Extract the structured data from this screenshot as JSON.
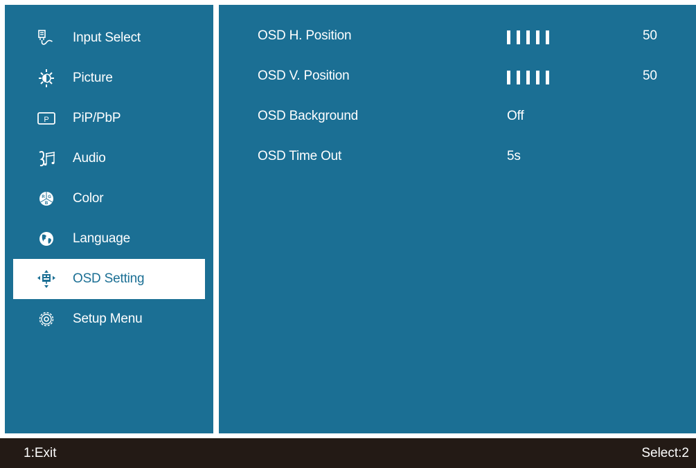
{
  "sidebar": {
    "items": [
      {
        "label": "Input Select",
        "icon": "input-select-icon"
      },
      {
        "label": "Picture",
        "icon": "brightness-icon"
      },
      {
        "label": "PiP/PbP",
        "icon": "pip-icon"
      },
      {
        "label": "Audio",
        "icon": "audio-icon"
      },
      {
        "label": "Color",
        "icon": "rgb-color-icon"
      },
      {
        "label": "Language",
        "icon": "globe-icon"
      },
      {
        "label": "OSD Setting",
        "icon": "osd-setting-icon",
        "selected": true
      },
      {
        "label": "Setup Menu",
        "icon": "gear-icon"
      }
    ]
  },
  "settings": [
    {
      "label": "OSD H. Position",
      "value": "50",
      "level": 0.5
    },
    {
      "label": "OSD V. Position",
      "value": "50",
      "level": 0.5
    },
    {
      "label": "OSD Background",
      "value": "Off"
    },
    {
      "label": "OSD Time Out",
      "value": "5s"
    }
  ],
  "footer": {
    "exit_label": "1:Exit",
    "select_label": "Select:2"
  },
  "colors": {
    "panel": "#1b6f94",
    "selected_bg": "#ffffff",
    "footer_bg": "#231a15",
    "text": "#ffffff"
  }
}
